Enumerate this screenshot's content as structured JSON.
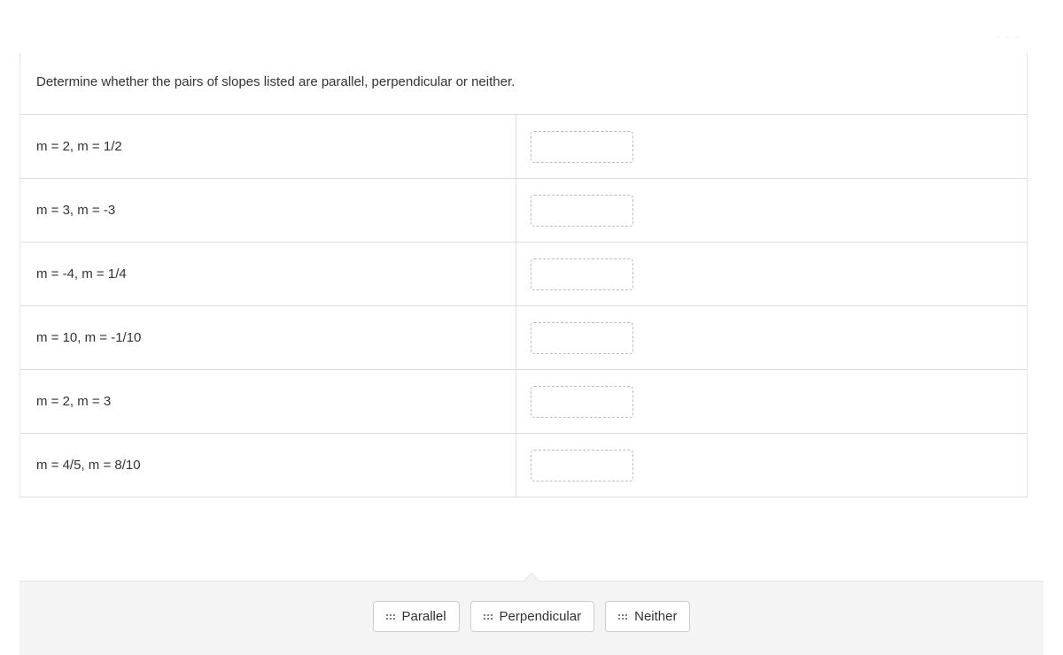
{
  "prompt": "Determine whether the pairs of slopes listed are parallel, perpendicular or neither.",
  "rows": [
    {
      "label": "m = 2, m = 1/2"
    },
    {
      "label": "m = 3, m = -3"
    },
    {
      "label": "m = -4, m = 1/4"
    },
    {
      "label": "m = 10, m = -1/10"
    },
    {
      "label": "m = 2, m = 3"
    },
    {
      "label": "m = 4/5, m = 8/10"
    }
  ],
  "tiles": [
    {
      "label": "Parallel"
    },
    {
      "label": "Perpendicular"
    },
    {
      "label": "Neither"
    }
  ]
}
